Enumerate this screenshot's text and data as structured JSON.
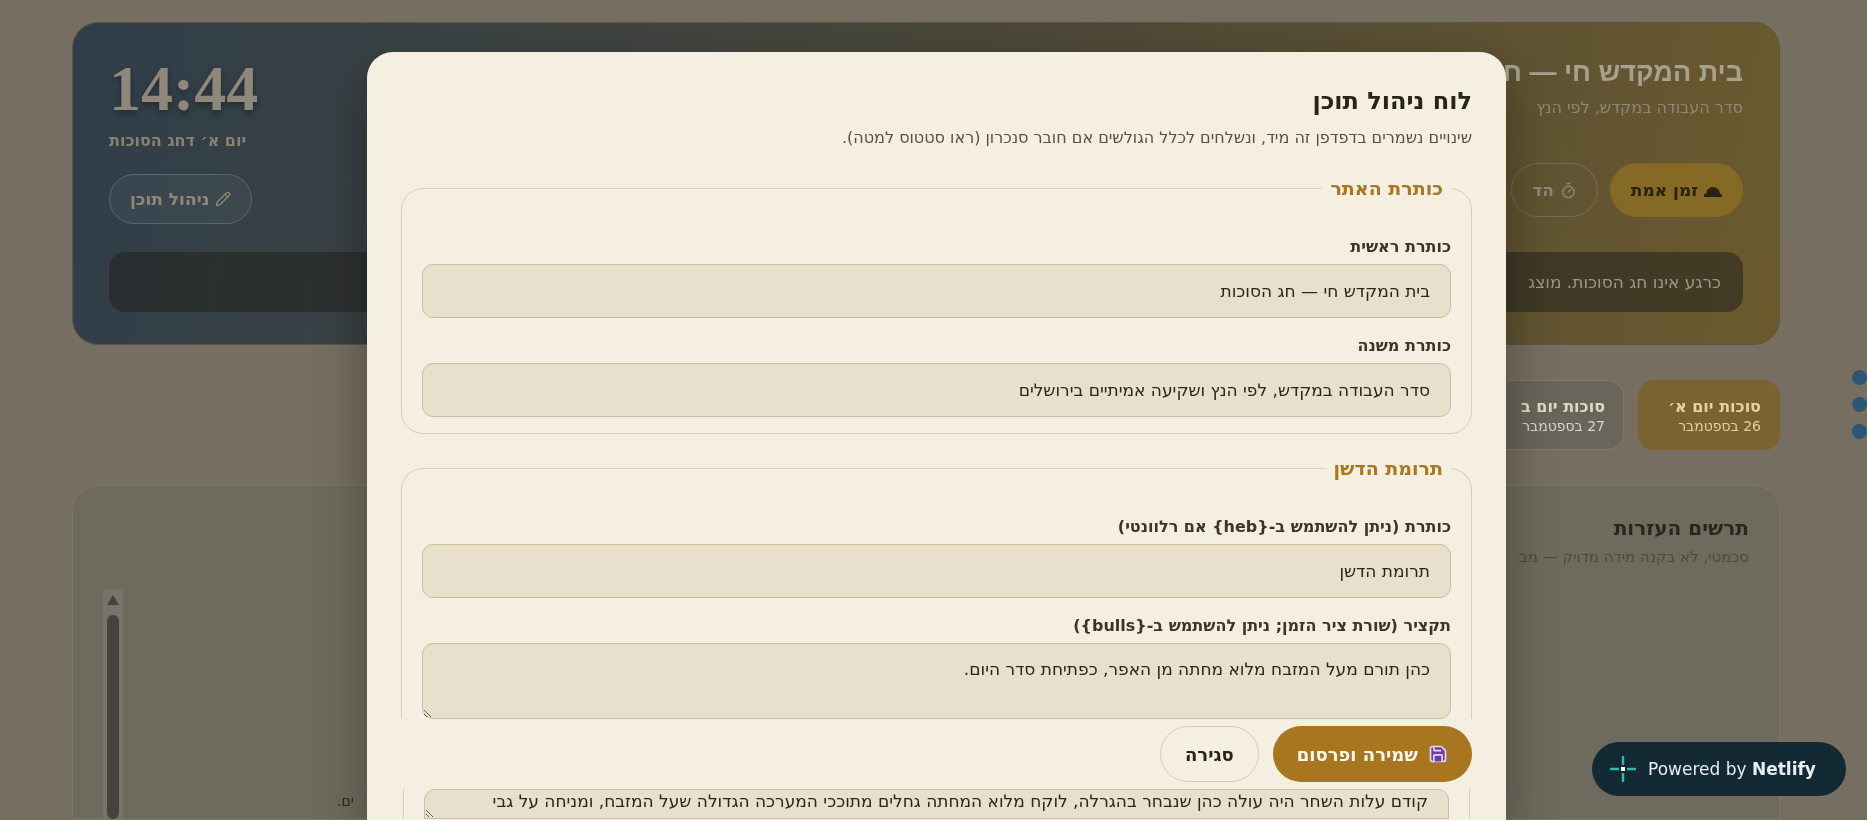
{
  "header": {
    "clock": "14:44",
    "date": "יום א׳ דחג הסוכות",
    "manage_button": "ניהול תוכן",
    "title": "בית המקדש חי — ח",
    "subtitle": "סדר העבודה במקדש, לפי הנץ",
    "mode_buttons": [
      {
        "label": "זמן אמת",
        "kind": "live",
        "selected": true
      },
      {
        "label": "הד",
        "kind": "demo",
        "selected": false
      }
    ],
    "notice": "כרגע אינו חג הסוכות. מוצג"
  },
  "day_tabs": [
    {
      "label": "סוכות יום א׳",
      "date": "26 בספטמבר",
      "selected": true
    },
    {
      "label": "סוכות יום ב",
      "date": "27 בספטמבר",
      "selected": false
    }
  ],
  "diagram_card": {
    "title": "תרשים העזרות",
    "subtitle": "סכמטי, לא בקנה מידה מדויק — מב",
    "fragment": "ים."
  },
  "modal": {
    "title": "לוח ניהול תוכן",
    "subtitle": "שינויים נשמרים בדפדפן זה מיד, ונשלחים לכלל הגולשים אם חובר סנכרון (ראו סטטוס למטה).",
    "sections": [
      {
        "legend": "כותרת האתר",
        "fields": [
          {
            "label": "כותרת ראשית",
            "value": "בית המקדש חי — חג הסוכות",
            "kind": "input"
          },
          {
            "label": "כותרת משנה",
            "value": "סדר העבודה במקדש, לפי הנץ ושקיעה אמיתיים בירושלים",
            "kind": "input"
          }
        ]
      },
      {
        "legend": "תרומת הדשן",
        "fields": [
          {
            "label": "כותרת (ניתן להשתמש ב-{heb} אם רלוונטי)",
            "value": "תרומת הדשן",
            "kind": "input"
          },
          {
            "label": "תקציר (שורת ציר הזמן; ניתן להשתמש ב-{bulls})",
            "value": "כהן תורם מעל המזבח מלוא מחתה מן האפר, כפתיחת סדר היום.",
            "kind": "textarea"
          },
          {
            "value": "קודם עלות השחר היה עולה כהן שנבחר בהגרלה, לוקח מלוא המחתה גחלים מתוככי המערכה הגדולה שעל המזבח, ומניחה על גבי",
            "kind": "textarea"
          }
        ]
      }
    ],
    "buttons": [
      {
        "label": "שמירה ופרסום",
        "kind": "primary"
      },
      {
        "label": "סגירה",
        "kind": "secondary"
      }
    ]
  },
  "badge": {
    "text": "Powered by **Netlify**"
  }
}
